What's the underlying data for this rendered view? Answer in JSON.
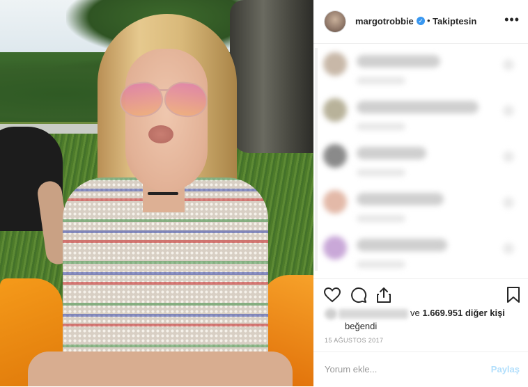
{
  "post": {
    "username": "margotrobbie",
    "verified_icon": "check-icon",
    "separator": "•",
    "follow_status": "Takiptesin",
    "more_icon": "more-horizontal-icon",
    "photo_alt": "profile photo"
  },
  "comments": [
    {
      "avatar_color": "#c8b8a8"
    },
    {
      "avatar_color": "#b8b29a"
    },
    {
      "avatar_color": "#8a8a8a"
    },
    {
      "avatar_color": "#e3b9a8"
    },
    {
      "avatar_color": "#c9a8d8"
    }
  ],
  "actions": {
    "like_icon": "heart-icon",
    "comment_icon": "comment-icon",
    "share_icon": "share-icon",
    "save_icon": "bookmark-icon"
  },
  "likes": {
    "prefix_text": "ve",
    "count": "1.669.951",
    "suffix_text": "diğer kişi",
    "liked_label": "beğendi"
  },
  "date": "15 AĞUSTOS 2017",
  "comment_box": {
    "placeholder": "Yorum ekle...",
    "submit_label": "Paylaş"
  },
  "colors": {
    "accent": "#3897f0",
    "text": "#262626",
    "muted": "#999999",
    "submit_disabled": "#b2dffc"
  }
}
